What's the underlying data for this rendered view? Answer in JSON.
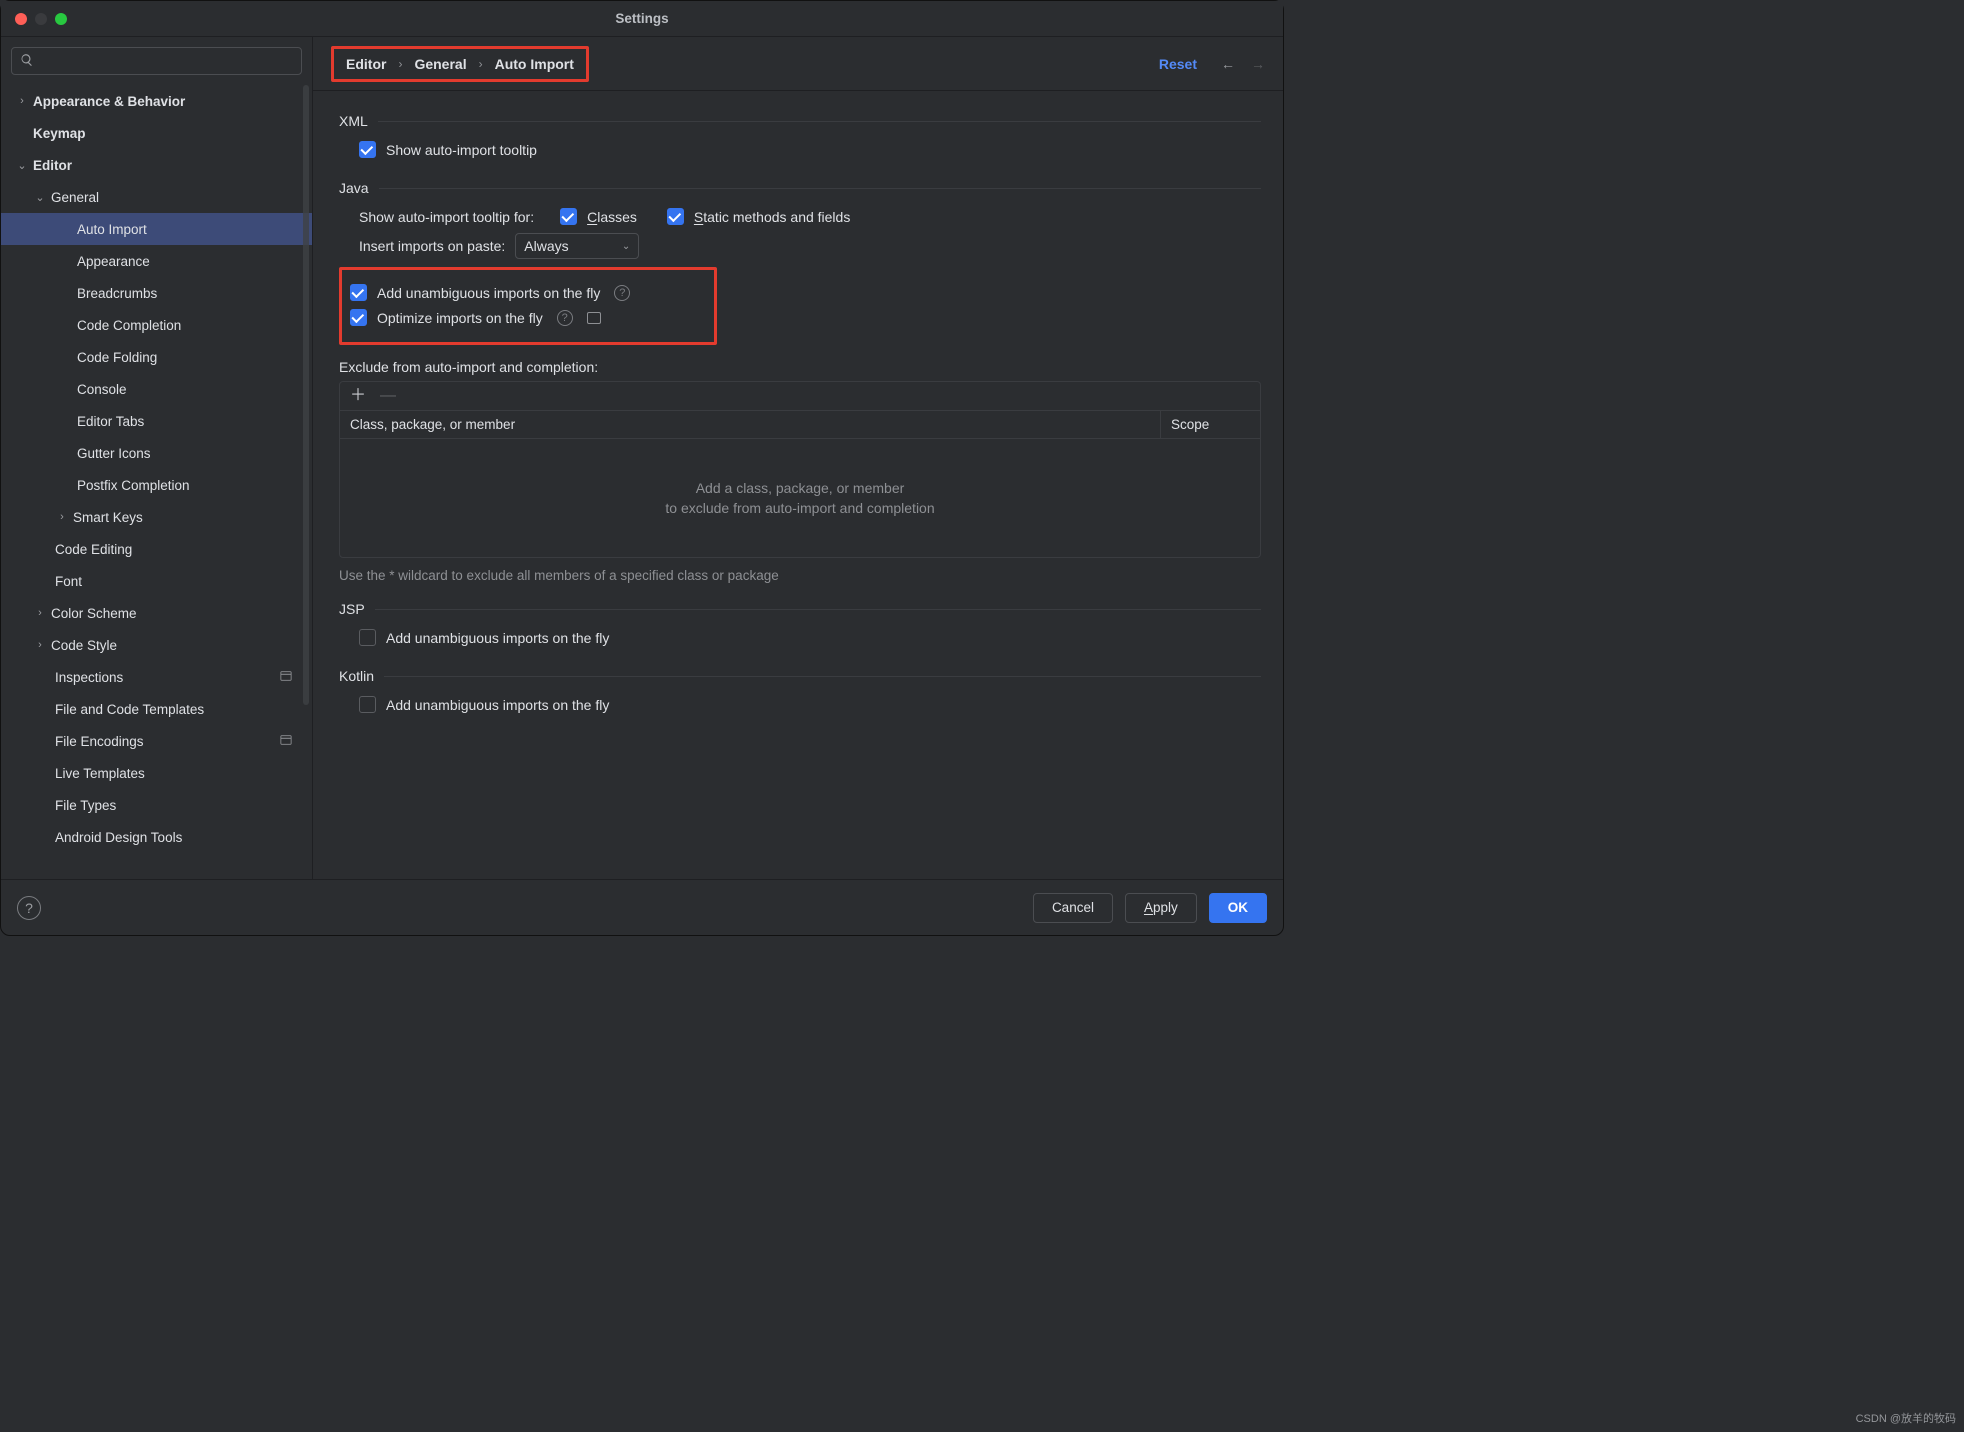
{
  "window": {
    "title": "Settings"
  },
  "sidebar": {
    "search_placeholder": "",
    "items": {
      "appearance_behavior": "Appearance & Behavior",
      "keymap": "Keymap",
      "editor": "Editor",
      "general": "General",
      "auto_import": "Auto Import",
      "appearance": "Appearance",
      "breadcrumbs": "Breadcrumbs",
      "code_completion": "Code Completion",
      "code_folding": "Code Folding",
      "console": "Console",
      "editor_tabs": "Editor Tabs",
      "gutter_icons": "Gutter Icons",
      "postfix_completion": "Postfix Completion",
      "smart_keys": "Smart Keys",
      "code_editing": "Code Editing",
      "font": "Font",
      "color_scheme": "Color Scheme",
      "code_style": "Code Style",
      "inspections": "Inspections",
      "file_code_templates": "File and Code Templates",
      "file_encodings": "File Encodings",
      "live_templates": "Live Templates",
      "file_types": "File Types",
      "android_design_tools": "Android Design Tools"
    }
  },
  "breadcrumb": {
    "p1": "Editor",
    "p2": "General",
    "p3": "Auto Import"
  },
  "topbar": {
    "reset": "Reset"
  },
  "xml": {
    "heading": "XML",
    "show_tooltip": "Show auto-import tooltip",
    "show_tooltip_checked": true
  },
  "java": {
    "heading": "Java",
    "tooltip_for_label": "Show auto-import tooltip for:",
    "classes_label": "Classes",
    "classes_checked": true,
    "static_label": "Static methods and fields",
    "static_checked": true,
    "insert_label": "Insert imports on paste:",
    "insert_value": "Always",
    "add_unambiguous": "Add unambiguous imports on the fly",
    "add_unambiguous_checked": true,
    "optimize": "Optimize imports on the fly",
    "optimize_checked": true,
    "exclude_label": "Exclude from auto-import and completion:",
    "table": {
      "col1": "Class, package, or member",
      "col2": "Scope",
      "empty1": "Add a class, package, or member",
      "empty2": "to exclude from auto-import and completion"
    },
    "wildcard_hint": "Use the * wildcard to exclude all members of a specified class or package"
  },
  "jsp": {
    "heading": "JSP",
    "add_unambiguous": "Add unambiguous imports on the fly",
    "checked": false
  },
  "kotlin": {
    "heading": "Kotlin",
    "add_unambiguous": "Add unambiguous imports on the fly",
    "checked": false
  },
  "footer": {
    "cancel": "Cancel",
    "apply": "Apply",
    "ok": "OK"
  },
  "watermark": "CSDN @放羊的牧码"
}
